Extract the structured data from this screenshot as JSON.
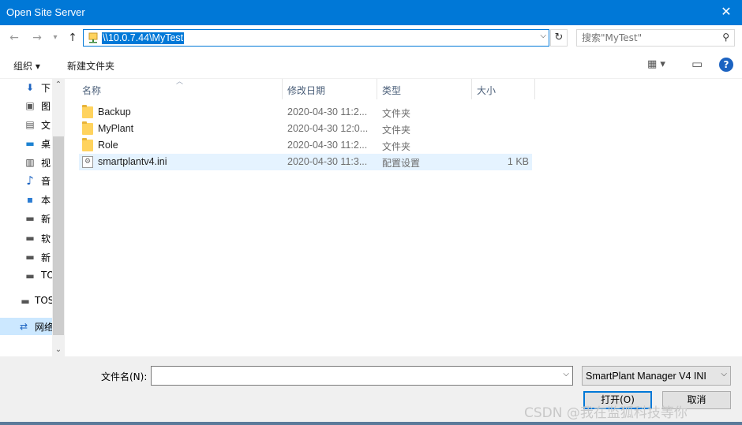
{
  "window": {
    "title": "Open Site Server",
    "close_glyph": "✕"
  },
  "nav": {
    "back_icon": "←",
    "forward_icon": "→",
    "history_icon": "▾",
    "up_icon": "↑",
    "address": "\\\\10.0.7.44\\MyTest",
    "address_dropdown_icon": "⌵",
    "refresh_icon": "↻",
    "search_placeholder": "搜索\"MyTest\"",
    "search_icon": "⚲"
  },
  "toolbar": {
    "organize": "组织 ▾",
    "new_folder": "新建文件夹",
    "view_icon": "▦ ▾",
    "preview_pane_icon": "▭",
    "help_icon": "?"
  },
  "sidebar": {
    "items": [
      {
        "icon": "download-icon",
        "glyph": "⬇",
        "label": "下"
      },
      {
        "icon": "pictures-icon",
        "glyph": "▣",
        "label": "图"
      },
      {
        "icon": "documents-icon",
        "glyph": "▤",
        "label": "文"
      },
      {
        "icon": "desktop-icon",
        "glyph": "▬",
        "label": "桌"
      },
      {
        "icon": "videos-icon",
        "glyph": "▥",
        "label": "视"
      },
      {
        "icon": "music-icon",
        "glyph": "♪",
        "label": "音"
      },
      {
        "icon": "this-pc-icon",
        "glyph": "▪",
        "label": "本"
      },
      {
        "icon": "drive-icon",
        "glyph": "▬",
        "label": "新"
      },
      {
        "icon": "drive-icon",
        "glyph": "▬",
        "label": "软"
      },
      {
        "icon": "drive-icon",
        "glyph": "▬",
        "label": "新"
      },
      {
        "icon": "drive-icon",
        "glyph": "▬",
        "label": "TO"
      },
      {
        "icon": "drive-icon",
        "glyph": "▬",
        "label": "TOS"
      },
      {
        "icon": "network-icon",
        "glyph": "⇄",
        "label": "网络"
      }
    ],
    "scroll_up_icon": "⌃",
    "scroll_down_icon": "⌄"
  },
  "columns": {
    "name": "名称",
    "modified": "修改日期",
    "type": "类型",
    "size": "大小",
    "sort_icon": "︿"
  },
  "files": [
    {
      "name": "Backup",
      "modified": "2020-04-30 11:2...",
      "type": "文件夹",
      "size": "",
      "kind": "folder"
    },
    {
      "name": "MyPlant",
      "modified": "2020-04-30 12:0...",
      "type": "文件夹",
      "size": "",
      "kind": "folder"
    },
    {
      "name": "Role",
      "modified": "2020-04-30 11:2...",
      "type": "文件夹",
      "size": "",
      "kind": "folder"
    },
    {
      "name": "smartplantv4.ini",
      "modified": "2020-04-30 11:3...",
      "type": "配置设置",
      "size": "1 KB",
      "kind": "ini"
    }
  ],
  "bottom": {
    "filename_label": "文件名(N):",
    "filename_value": "",
    "filter_value": "SmartPlant Manager V4 INI",
    "open_button": "打开(O)",
    "cancel_button": "取消",
    "dropdown_icon": "⌵",
    "watermark": "CSDN @我在监狐科技等你"
  },
  "colors": {
    "accent": "#0078d7",
    "selection": "#cce8ff",
    "hover_row": "#e5f3ff",
    "panel": "#f0f0f0"
  }
}
